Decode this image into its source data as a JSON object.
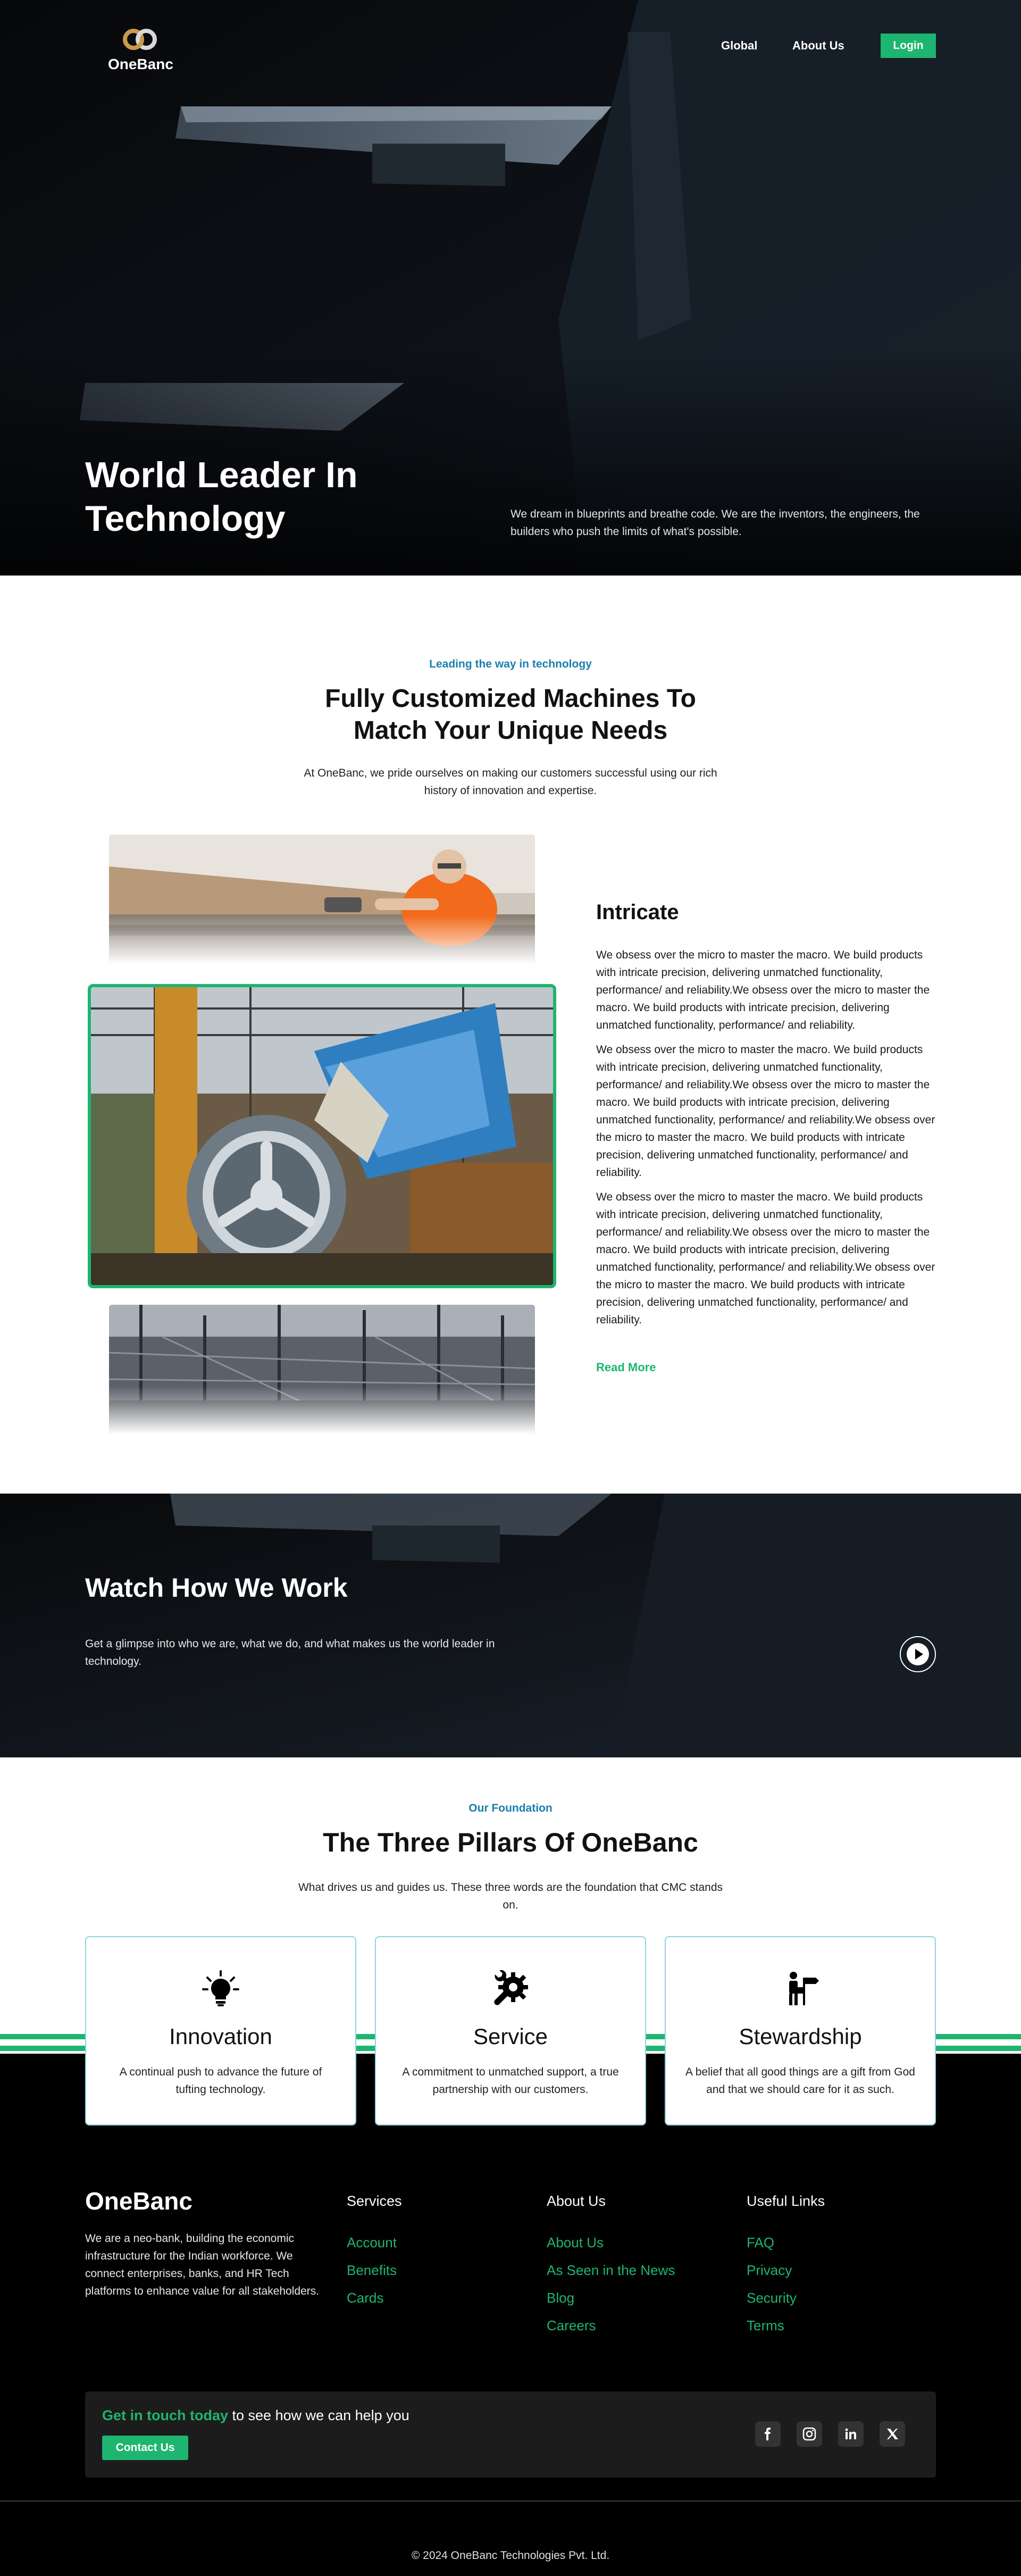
{
  "brand": {
    "name": "OneBanc"
  },
  "nav": {
    "items": [
      "Global",
      "About Us"
    ],
    "login": "Login"
  },
  "hero": {
    "title": "World Leader In Technology",
    "description": "We dream in blueprints and breathe code. We are the inventors, the engineers, the builders who push the limits of what's possible."
  },
  "customized": {
    "eyebrow": "Leading the way in technology",
    "title_line1": "Fully Customized Machines To",
    "title_line2": "Match Your Unique Needs",
    "description": "At OneBanc, we pride ourselves on making our customers successful using our rich history of innovation and expertise.",
    "active_title": "Intricate",
    "paragraphs": [
      "We obsess over the micro to master the macro. We build products with intricate precision, delivering unmatched functionality, performance/ and reliability.We obsess over the micro to master the macro. We build products with intricate precision, delivering unmatched functionality, performance/ and reliability.",
      "We obsess over the micro to master the macro. We build products with intricate precision, delivering unmatched functionality, performance/ and reliability.We obsess over the micro to master the macro. We build products with intricate precision, delivering unmatched functionality, performance/ and reliability.We obsess over the micro to master the macro. We build products with intricate precision, delivering unmatched functionality, performance/ and reliability.",
      "We obsess over the micro to master the macro. We build products with intricate precision, delivering unmatched functionality, performance/ and reliability.We obsess over the micro to master the macro. We build products with intricate precision, delivering unmatched functionality, performance/ and reliability.We obsess over the micro to master the macro. We build products with intricate precision, delivering unmatched functionality, performance/ and reliability."
    ],
    "read_more": "Read More"
  },
  "video": {
    "title": "Watch How We Work",
    "description": "Get a glimpse into who we are, what we do, and what makes us the world leader in technology.",
    "play_icon": "play-icon"
  },
  "pillars": {
    "eyebrow": "Our Foundation",
    "title": "The Three Pillars Of OneBanc",
    "description": "What drives us and guides us. These three words are the foundation that CMC stands on.",
    "items": [
      {
        "title": "Innovation",
        "description": "A continual push to advance the future of tufting technology.",
        "icon": "lightbulb-icon"
      },
      {
        "title": "Service",
        "description": "A commitment to unmatched support, a true partnership with our customers.",
        "icon": "wrench-gear-icon"
      },
      {
        "title": "Stewardship",
        "description": "A belief that all good things are a gift from God and that we should care for it as such.",
        "icon": "person-signpost-icon"
      }
    ]
  },
  "footer": {
    "brand": "OneBanc",
    "about": "We are a neo-bank, building the economic infrastructure for the Indian workforce. We connect enterprises, banks, and HR Tech platforms to enhance value for all stakeholders.",
    "columns": [
      {
        "title": "Services",
        "links": [
          "Account",
          "Benefits",
          "Cards"
        ]
      },
      {
        "title": "About Us",
        "links": [
          "About Us",
          "As Seen in the News",
          "Blog",
          "Careers"
        ]
      },
      {
        "title": "Useful Links",
        "links": [
          "FAQ",
          "Privacy",
          "Security",
          "Terms"
        ]
      }
    ],
    "cta_highlight": "Get in touch today",
    "cta_rest": " to see how we can help you",
    "contact_button": "Contact Us",
    "social": [
      "facebook-icon",
      "instagram-icon",
      "linkedin-icon",
      "x-icon"
    ],
    "copyright": "© 2024 OneBanc Technologies Pvt. Ltd."
  },
  "colors": {
    "accent": "#1db56f",
    "eyebrow": "#1a7fae",
    "dark": "#000000"
  }
}
